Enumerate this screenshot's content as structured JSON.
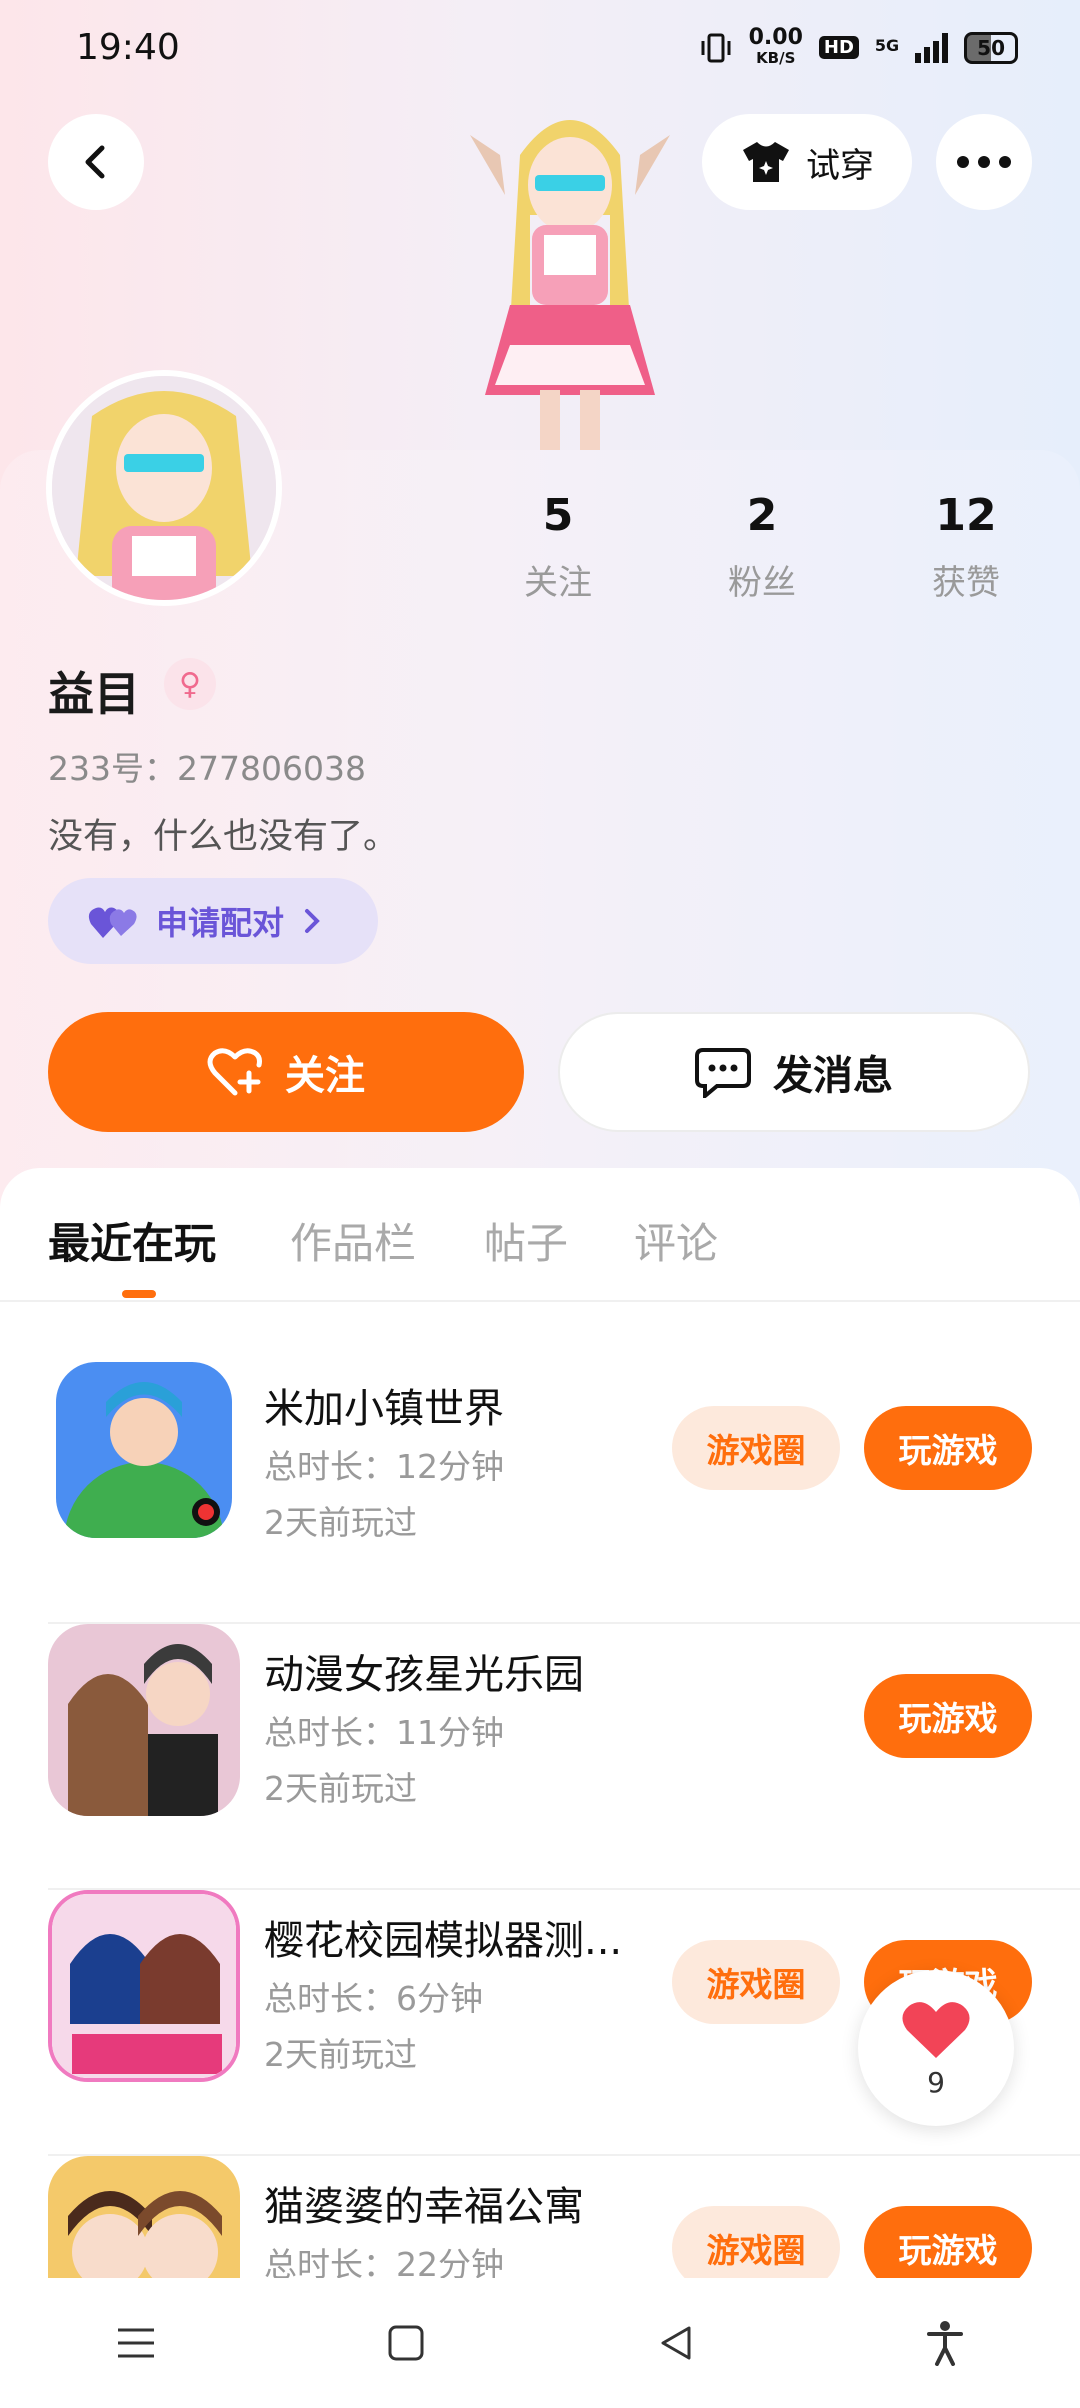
{
  "status_bar": {
    "time": "19:40",
    "net_speed": "0.00",
    "net_unit": "KB/S",
    "hd": "HD",
    "network": "5G",
    "battery": "50"
  },
  "header": {
    "tryon_label": "试穿"
  },
  "profile": {
    "stats": [
      {
        "value": "5",
        "label": "关注"
      },
      {
        "value": "2",
        "label": "粉丝"
      },
      {
        "value": "12",
        "label": "获赞"
      }
    ],
    "name": "益目",
    "uid": "233号：277806038",
    "bio": "没有，什么也没有了。",
    "pair_label": "申请配对",
    "follow_label": "关注",
    "message_label": "发消息"
  },
  "tabs": [
    "最近在玩",
    "作品栏",
    "帖子",
    "评论"
  ],
  "games": [
    {
      "title": "米加小镇世界",
      "duration": "总时长：12分钟",
      "last_played": "2天前玩过",
      "circle": "游戏圈",
      "play": "玩游戏"
    },
    {
      "title": "动漫女孩星光乐园",
      "duration": "总时长：11分钟",
      "last_played": "2天前玩过",
      "circle": "",
      "play": "玩游戏"
    },
    {
      "title": "樱花校园模拟器测...",
      "duration": "总时长：6分钟",
      "last_played": "2天前玩过",
      "circle": "游戏圈",
      "play": "玩游戏"
    },
    {
      "title": "猫婆婆的幸福公寓",
      "duration": "总时长：22分钟",
      "last_played": "",
      "circle": "游戏圈",
      "play": "玩游戏"
    }
  ],
  "like_float": {
    "count": "9"
  },
  "colors": {
    "accent": "#ff6e0d",
    "pair": "#6a55d8"
  },
  "icons": [
    "back-icon",
    "shirt-icon",
    "more-icon",
    "heart-icon",
    "chat-icon",
    "menu-icon",
    "home-icon",
    "nav-back-icon",
    "accessibility-icon"
  ]
}
